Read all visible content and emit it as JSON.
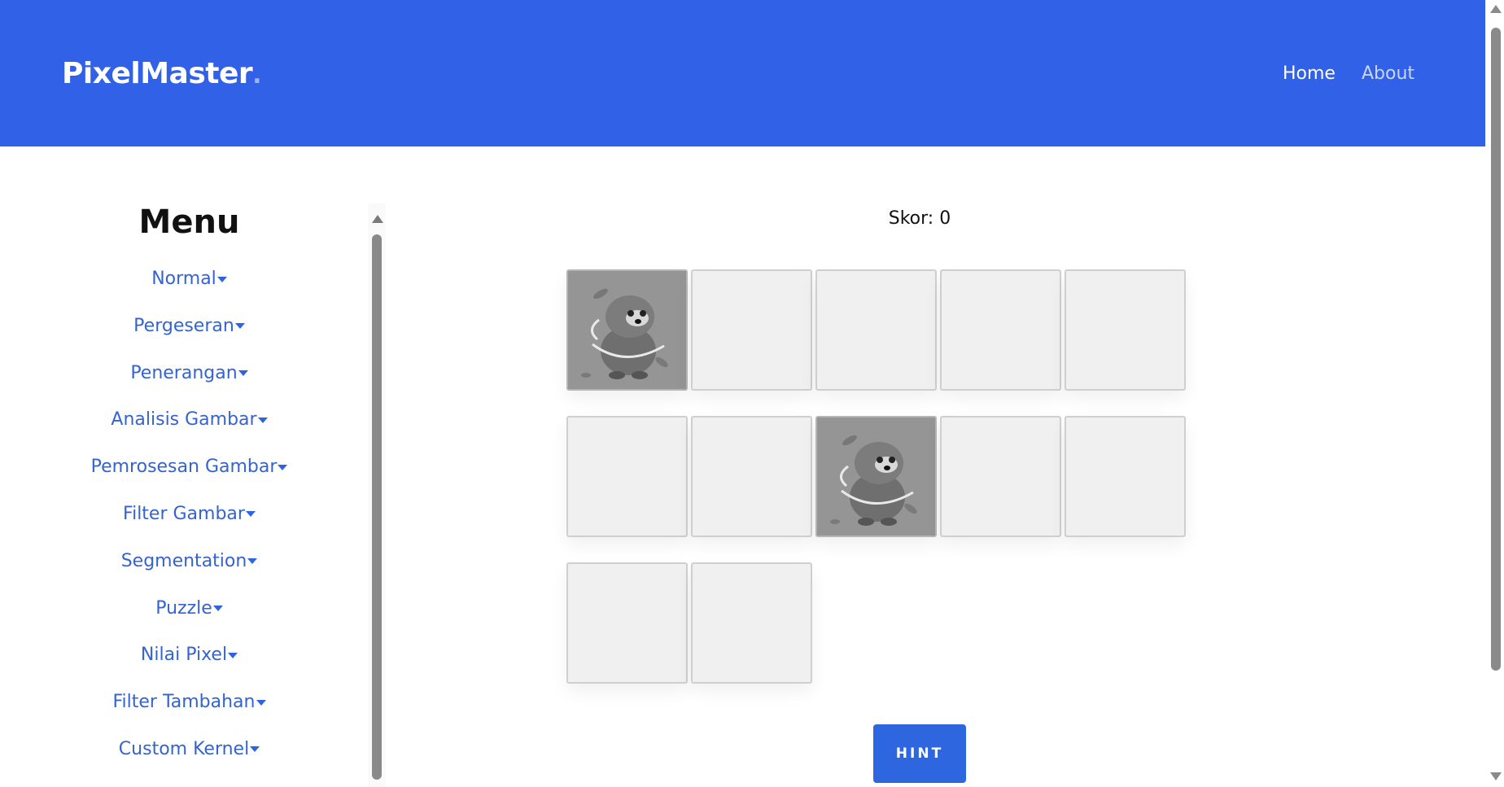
{
  "navbar": {
    "brand": "PixelMaster",
    "brand_dot": ".",
    "links": [
      {
        "label": "Home"
      },
      {
        "label": "About"
      }
    ]
  },
  "sidebar": {
    "title": "Menu",
    "items": [
      {
        "label": "Normal"
      },
      {
        "label": "Pergeseran"
      },
      {
        "label": "Penerangan"
      },
      {
        "label": "Analisis Gambar"
      },
      {
        "label": "Pemrosesan Gambar"
      },
      {
        "label": "Filter Gambar"
      },
      {
        "label": "Segmentation"
      },
      {
        "label": "Puzzle"
      },
      {
        "label": "Nilai Pixel"
      },
      {
        "label": "Filter Tambahan"
      },
      {
        "label": "Custom Kernel"
      }
    ]
  },
  "game": {
    "score_label": "Skor: 0",
    "cards": [
      {
        "state": "flipped",
        "image": "otter-icon"
      },
      {
        "state": "hidden"
      },
      {
        "state": "hidden"
      },
      {
        "state": "hidden"
      },
      {
        "state": "hidden"
      },
      {
        "state": "hidden"
      },
      {
        "state": "hidden"
      },
      {
        "state": "flipped",
        "image": "otter-icon"
      },
      {
        "state": "hidden"
      },
      {
        "state": "hidden"
      },
      {
        "state": "hidden"
      },
      {
        "state": "hidden"
      }
    ],
    "hint_label": "HINT"
  },
  "colors": {
    "navbar": "#3061e7",
    "menu_link": "#3563cf",
    "hint_button": "#2e66df"
  }
}
